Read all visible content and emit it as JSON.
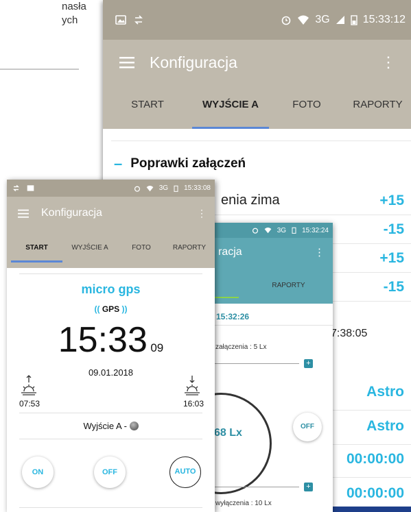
{
  "background": {
    "text_line1": "nasła",
    "text_line2": "ych"
  },
  "phone_main": {
    "status_time": "15:33:12",
    "network": "3G",
    "title": "Konfiguracja",
    "tabs": [
      "START",
      "WYJŚCIE A",
      "FOTO",
      "RAPORTY"
    ],
    "section_title": "Poprawki załączeń",
    "rows": [
      {
        "label": "enia zima",
        "value": "+15"
      },
      {
        "label": "",
        "value": "-15"
      },
      {
        "label": "",
        "value": "+15"
      },
      {
        "label": "",
        "value": "-15"
      }
    ],
    "time_readout": "7:38:05",
    "right_values": [
      "Astro",
      "Astro",
      "00:00:00",
      "00:00:00"
    ]
  },
  "phone_lux": {
    "status_time": "15:32:24",
    "network": "3G",
    "title": "racja",
    "tab": "RAPORTY",
    "clock": "15:32:26",
    "on_threshold": "załączenia : 5 Lx",
    "lux": "68 Lx",
    "off_label": "OFF",
    "off_threshold": "wyłączenia : 10 Lx",
    "plus_label": "+"
  },
  "phone_start": {
    "status_time": "15:33:08",
    "network": "3G",
    "title": "Konfiguracja",
    "tabs": [
      "START",
      "WYJŚCIE A",
      "FOTO",
      "RAPORTY"
    ],
    "device": "micro gps",
    "gps_badge": "GPS",
    "time_main": "15:33",
    "time_seconds": "09",
    "date": "09.01.2018",
    "sunrise": "07:53",
    "sunset": "16:03",
    "output_label": "Wyjście A -",
    "buttons": {
      "on": "ON",
      "off": "OFF",
      "auto": "AUTO"
    }
  },
  "colors": {
    "accent": "#29b6e0",
    "teal": "#5ea8b4",
    "appbar": "#c0baad",
    "tab_indicator": "#5b87d6"
  }
}
